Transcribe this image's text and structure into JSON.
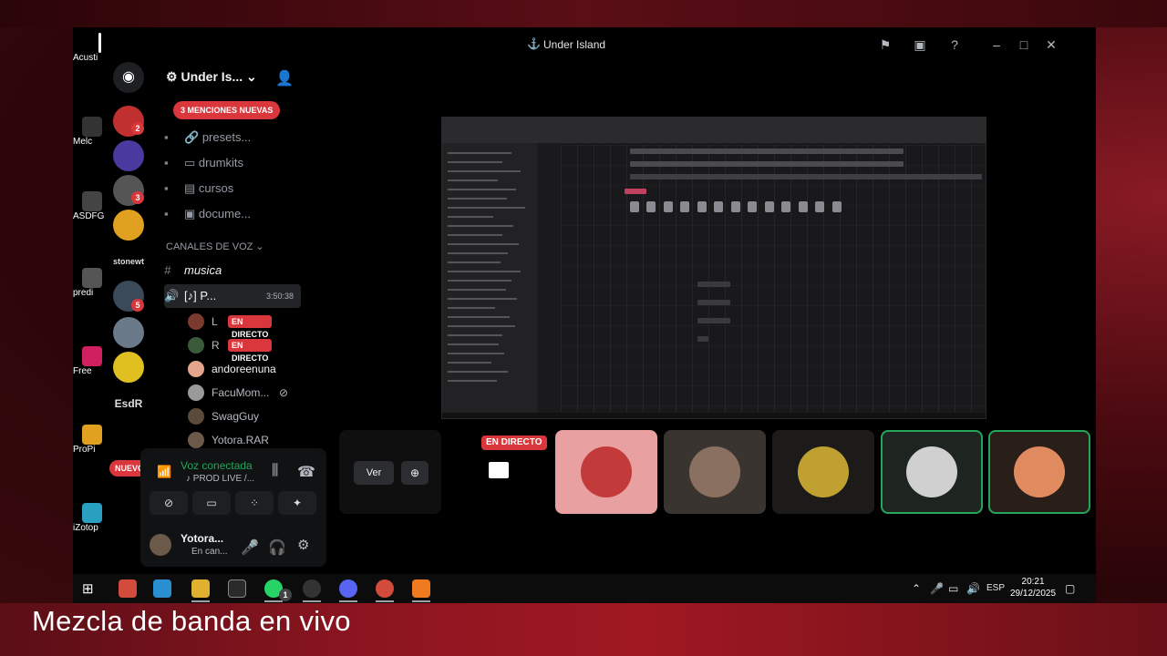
{
  "window": {
    "title": "Under Island"
  },
  "desktop_icons": [
    "Acusti",
    "Melc",
    "ASDFG",
    "predi",
    "Free",
    "ProPi",
    "iZotop"
  ],
  "server_rail": {
    "badges": [
      "2",
      "3",
      "5"
    ],
    "text_servers": [
      "stonewt",
      "EsdR"
    ],
    "nuevo": "NUEVO"
  },
  "server": {
    "name": "Under Is...",
    "mentions": "3 MENCIONES NUEVAS",
    "text_channels": [
      {
        "icon": "🔗",
        "name": "presets..."
      },
      {
        "icon": "▭",
        "name": "drumkits"
      },
      {
        "icon": "▤",
        "name": "cursos"
      },
      {
        "icon": "▣",
        "name": "docume..."
      }
    ],
    "voice_category": "CANALES DE VOZ",
    "musica": "musica",
    "active_voice": {
      "name": "P...",
      "time": "3:50:38"
    },
    "users": [
      {
        "name": "L",
        "live": "EN DIRECTO",
        "color": "#7a3b2e"
      },
      {
        "name": "R",
        "live": "EN DIRECTO",
        "color": "#3b5a3a"
      },
      {
        "name": "andoreenuna",
        "live": "",
        "color": "#e3a58c"
      },
      {
        "name": "FacuMom...",
        "live": "",
        "color": "#9a9a9a"
      },
      {
        "name": "SwagGuy",
        "live": "",
        "color": "#5a4a3a"
      },
      {
        "name": "Yotora.RAR",
        "live": "",
        "color": "#6b5a4a"
      }
    ]
  },
  "voice_panel": {
    "title": "Voz conectada",
    "subtitle": "PROD LIVE /...",
    "user": "Yotora...",
    "status": "En can..."
  },
  "stage": {
    "live_tag": "EN DIRECTO",
    "ver": "Ver",
    "participants": [
      {
        "bg": "#e8a0a0",
        "avatar": "#c23a3a"
      },
      {
        "bg": "#3a3430",
        "avatar": "#8a7060"
      },
      {
        "bg": "#1c1b1a",
        "avatar": "#c0a030"
      },
      {
        "bg": "#1e2520",
        "avatar": "#d0d0d0"
      },
      {
        "bg": "#2a1e18",
        "avatar": "#e08a60"
      }
    ]
  },
  "taskbar": {
    "lang": "ESP",
    "time": "20:21",
    "date": "29/12/2025",
    "notif": "1"
  },
  "caption": "Mezcla de banda en vivo",
  "colors": {
    "accent_red": "#da373c",
    "green": "#23a55a"
  }
}
